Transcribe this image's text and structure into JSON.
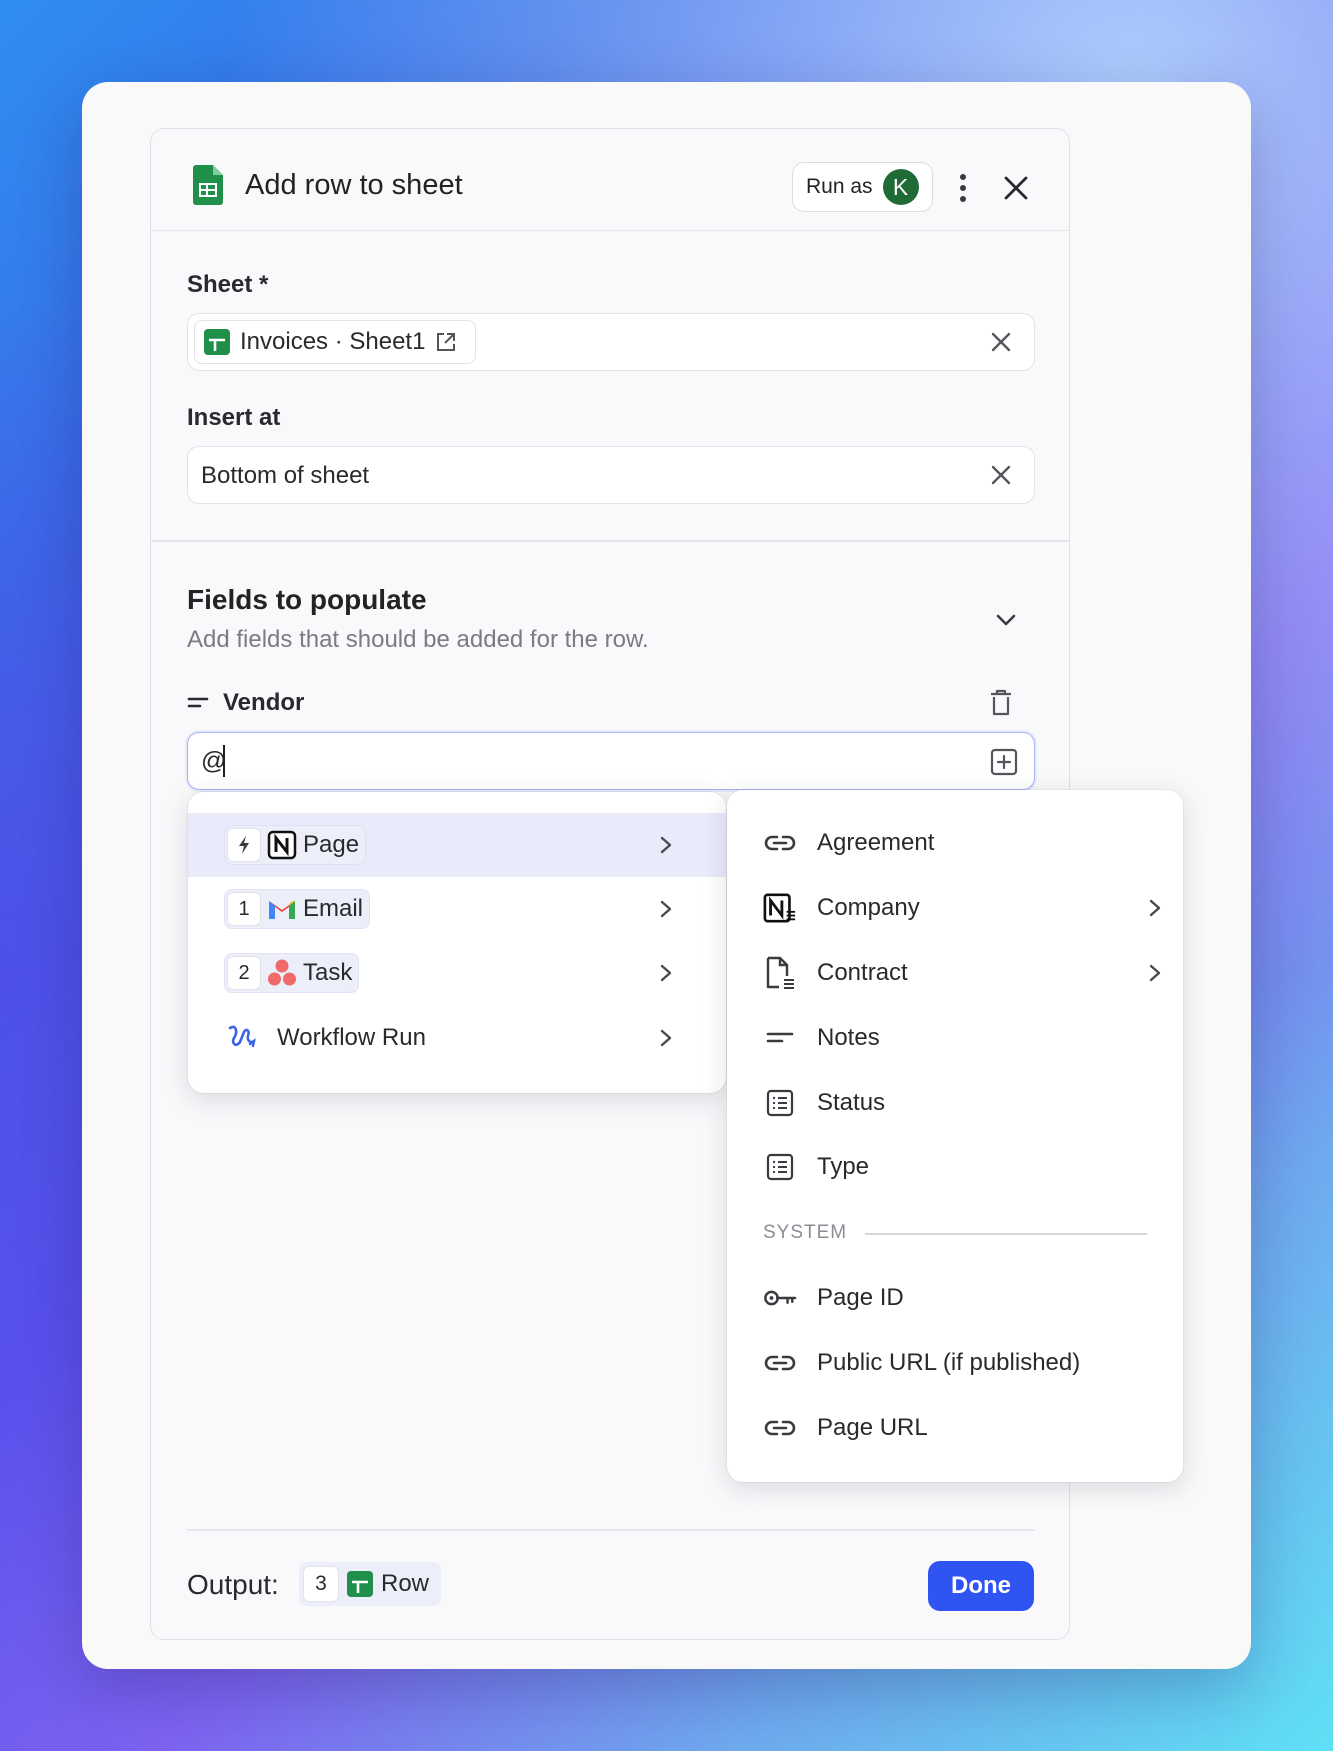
{
  "dialog": {
    "title": "Add row to sheet",
    "run_as_label": "Run as",
    "avatar_initial": "K"
  },
  "sheet": {
    "label": "Sheet *",
    "value": "Invoices · Sheet1"
  },
  "insert_at": {
    "label": "Insert at",
    "value": "Bottom of sheet"
  },
  "fields_section": {
    "title": "Fields to populate",
    "subtitle": "Add fields that should be added for the row."
  },
  "vendor_field": {
    "label": "Vendor",
    "value": "@"
  },
  "source_menu": {
    "items": [
      {
        "step": "",
        "label": "Page",
        "icon": "notion-icon",
        "active": true
      },
      {
        "step": "1",
        "label": "Email",
        "icon": "gmail-icon",
        "active": false
      },
      {
        "step": "2",
        "label": "Task",
        "icon": "asana-icon",
        "active": false
      },
      {
        "step": "",
        "label": "Workflow Run",
        "icon": "workflow-icon",
        "active": false
      }
    ]
  },
  "property_menu": {
    "items": [
      {
        "label": "Agreement",
        "icon": "link-icon",
        "has_submenu": false
      },
      {
        "label": "Company",
        "icon": "notion-icon",
        "has_submenu": true
      },
      {
        "label": "Contract",
        "icon": "document-icon",
        "has_submenu": true
      },
      {
        "label": "Notes",
        "icon": "text-icon",
        "has_submenu": false
      },
      {
        "label": "Status",
        "icon": "list-icon",
        "has_submenu": false
      },
      {
        "label": "Type",
        "icon": "list-icon",
        "has_submenu": false
      }
    ],
    "system_header": "SYSTEM",
    "system_items": [
      {
        "label": "Page ID",
        "icon": "key-icon"
      },
      {
        "label": "Public URL (if published)",
        "icon": "link-icon"
      },
      {
        "label": "Page URL",
        "icon": "link-icon"
      }
    ]
  },
  "footer": {
    "output_label": "Output:",
    "output_step": "3",
    "output_value": "Row",
    "done_label": "Done"
  },
  "colors": {
    "primary": "#2f54f2",
    "sheets_green": "#1f8f4a",
    "active_row": "#e9ebfb"
  }
}
